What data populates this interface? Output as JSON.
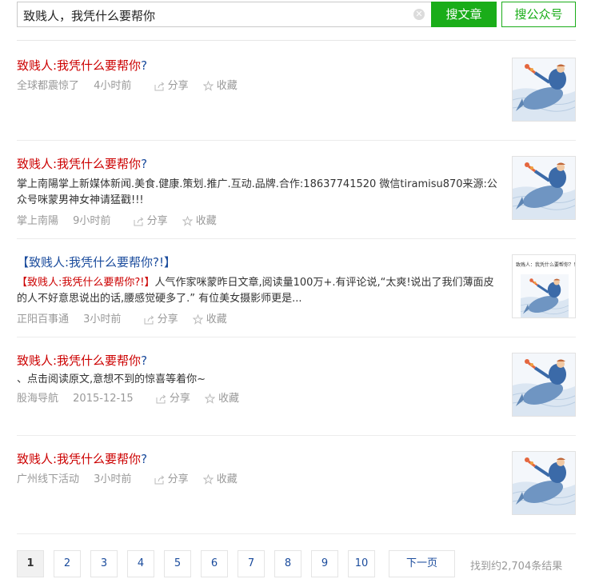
{
  "search": {
    "query": "致贱人，我凭什么要帮你",
    "clear_icon": "close-icon",
    "search_articles_label": "搜文章",
    "search_accounts_label": "搜公众号"
  },
  "results": [
    {
      "title_main": "致贱人:我凭什么要帮你",
      "title_tail": "?",
      "summary": "",
      "source": "全球都震惊了",
      "time": "4小时前",
      "share": "分享",
      "collect": "收藏",
      "thumb": "illustration-whale-swimmer"
    },
    {
      "title_main": "致贱人:我凭什么要帮你",
      "title_tail": "?",
      "summary": "掌上南陽掌上新媒体新闻.美食.健康.策划.推广.互动.品牌.合作:18637741520 微信tiramisu870来源:公众号咪蒙男神女神请猛戳!!!",
      "source": "掌上南陽",
      "time": "9小时前",
      "share": "分享",
      "collect": "收藏",
      "thumb": "illustration-whale-swimmer"
    },
    {
      "title_main": "【致贱人:我凭什么要帮你?!】",
      "title_tail": "",
      "summary_highlight": "【致贱人:我凭什么要帮你?!】",
      "summary": "人气作家咪蒙昨日文章,阅读量100万+.有评论说,“太爽!说出了我们薄面皮的人不好意思说出的话,腰感觉硬多了.” 有位美女摄影师更是...",
      "source": "正阳百事通",
      "time": "3小时前",
      "share": "分享",
      "collect": "收藏",
      "thumb_caption": "致贱人：我凭什么要帮你？！",
      "thumb": "article-cover-whale"
    },
    {
      "title_main": "致贱人:我凭什么要帮你",
      "title_tail": "?",
      "summary": "、点击阅读原文,意想不到的惊喜等着你~",
      "source": "股海导航",
      "time": "2015-12-15",
      "share": "分享",
      "collect": "收藏",
      "thumb": "illustration-whale-swimmer"
    },
    {
      "title_main": "致贱人:我凭什么要帮你",
      "title_tail": "?",
      "summary": "",
      "source": "广州线下活动",
      "time": "3小时前",
      "share": "分享",
      "collect": "收藏",
      "thumb": "illustration-whale-swimmer"
    }
  ],
  "pagination": {
    "pages": [
      "1",
      "2",
      "3",
      "4",
      "5",
      "6",
      "7",
      "8",
      "9",
      "10"
    ],
    "current": "1",
    "next_label": "下一页",
    "found_text": "找到约2,704条结果"
  },
  "colors": {
    "accent_green": "#1aad19",
    "title_red": "#cc0000",
    "link_blue": "#1a4b9c",
    "meta_gray": "#999999"
  }
}
